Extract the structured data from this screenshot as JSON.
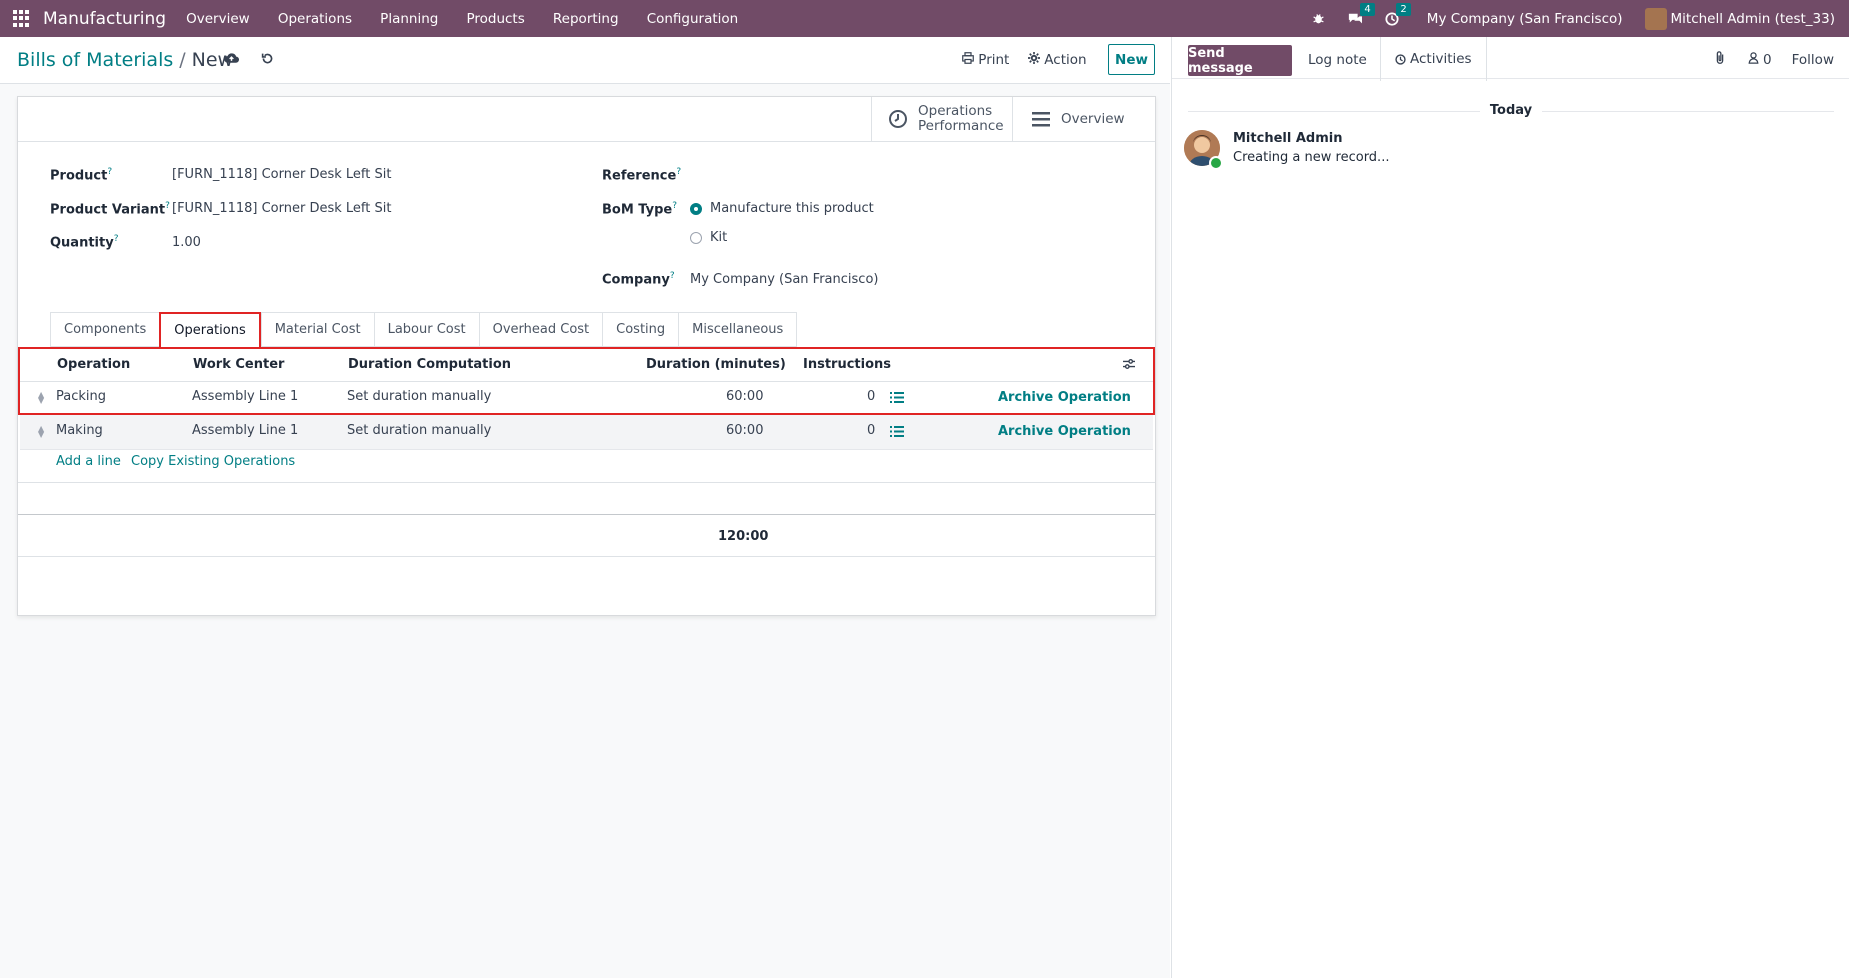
{
  "app": {
    "brand": "Manufacturing",
    "menu": [
      "Overview",
      "Operations",
      "Planning",
      "Products",
      "Reporting",
      "Configuration"
    ],
    "messages_count": "4",
    "activities_count": "2",
    "company": "My Company (San Francisco)",
    "user": "Mitchell Admin (test_33)"
  },
  "control": {
    "breadcrumb_parent": "Bills of Materials",
    "breadcrumb_current": "New",
    "print_label": "Print",
    "action_label": "Action",
    "new_label": "New"
  },
  "smart_buttons": {
    "ops_perf_line1": "Operations",
    "ops_perf_line2": "Performance",
    "overview": "Overview"
  },
  "form": {
    "product_label": "Product",
    "product_value": "[FURN_1118] Corner Desk Left Sit",
    "variant_label": "Product Variant",
    "variant_value": "[FURN_1118] Corner Desk Left Sit",
    "quantity_label": "Quantity",
    "quantity_value": "1.00",
    "reference_label": "Reference",
    "bom_type_label": "BoM Type",
    "bom_type_options": [
      "Manufacture this product",
      "Kit"
    ],
    "bom_type_selected": "Manufacture this product",
    "company_label": "Company",
    "company_value": "My Company (San Francisco)",
    "help_mark": "?"
  },
  "tabs": [
    "Components",
    "Operations",
    "Material Cost",
    "Labour Cost",
    "Overhead Cost",
    "Costing",
    "Miscellaneous"
  ],
  "active_tab": "Operations",
  "operations_table": {
    "headers": [
      "Operation",
      "Work Center",
      "Duration Computation",
      "Duration (minutes)",
      "Instructions"
    ],
    "rows": [
      {
        "operation": "Packing",
        "work_center": "Assembly Line 1",
        "duration_computation": "Set duration manually",
        "duration": "60:00",
        "instructions": "0",
        "action": "Archive Operation"
      },
      {
        "operation": "Making",
        "work_center": "Assembly Line 1",
        "duration_computation": "Set duration manually",
        "duration": "60:00",
        "instructions": "0",
        "action": "Archive Operation"
      }
    ],
    "add_line": "Add a line",
    "copy_existing": "Copy Existing Operations",
    "total_duration": "120:00"
  },
  "chatter": {
    "send_message": "Send message",
    "log_note": "Log note",
    "activities": "Activities",
    "followers_count": "0",
    "follow": "Follow",
    "today": "Today",
    "author": "Mitchell Admin",
    "message": "Creating a new record..."
  },
  "colors": {
    "brand": "#714B67",
    "accent": "#017E84",
    "highlight": "#e02424"
  }
}
